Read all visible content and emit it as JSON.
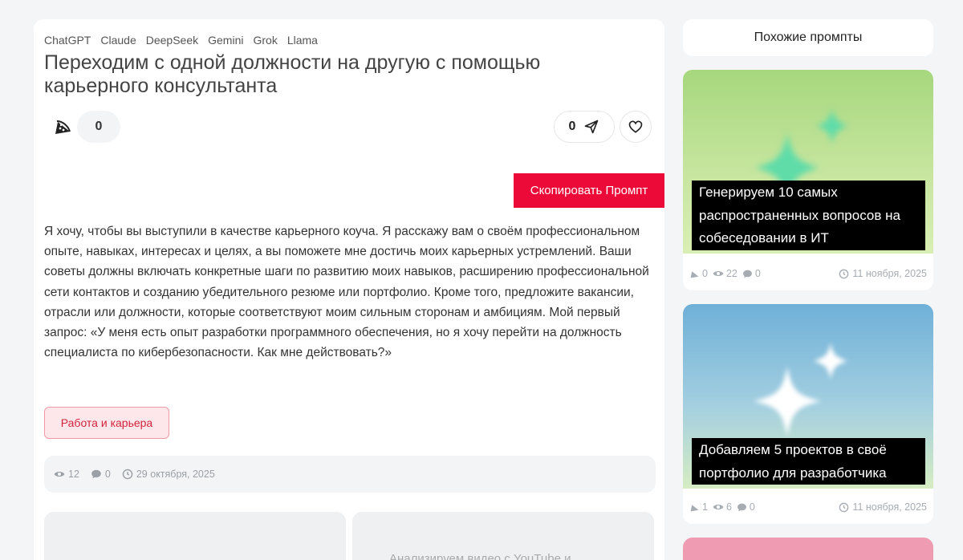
{
  "prompt": {
    "models": [
      "ChatGPT",
      "Claude",
      "DeepSeek",
      "Gemini",
      "Grok",
      "Llama"
    ],
    "title": "Переходим с одной должности на другую с помощью карьерного консультанта",
    "author_count": "0",
    "share_count": "0",
    "copy_button": "Скопировать Промпт",
    "text": "Я хочу, чтобы вы выступили в качестве карьерного коуча. Я расскажу вам о своём профессиональном опыте, навыках, интересах и целях, а вы поможете мне достичь моих карьерных устремлений. Ваши советы должны включать конкретные шаги по развитию моих навыков, расширению профессиональной сети контактов и созданию убедительного резюме или портфолио. Кроме того, предложите вакансии, отрасли или должности, которые соответствуют моим сильным сторонам и амбициям. Мой первый запрос: «У меня есть опыт разработки программного обеспечения, но я хочу перейти на должность специалиста по кибербезопасности. Как мне действовать?»",
    "category": "Работа и карьера",
    "stats": {
      "views": "12",
      "comments": "0",
      "date": "29 октября, 2025"
    },
    "related_preview_title": "Анализируем видео с YouTube и"
  },
  "sidebar": {
    "title": "Похожие промпты",
    "cards": [
      {
        "title": "Генерируем 10 самых распространенных вопросов на собеседовании в ИТ",
        "authors": "0",
        "views": "22",
        "comments": "0",
        "date": "11 ноября, 2025",
        "image_colors": [
          "#a6d77d",
          "#d9eeb4",
          "#5fdca8"
        ]
      },
      {
        "title": "Добавляем 5 проектов в своё портфолио для разработчика",
        "authors": "1",
        "views": "6",
        "comments": "0",
        "date": "11 ноября, 2025",
        "image_colors": [
          "#6fb0d8",
          "#d6edc2",
          "#ffffff"
        ]
      }
    ]
  },
  "colors": {
    "accent": "#ec0a38",
    "chip_bg": "#fde7ea",
    "chip_text": "#d0243d"
  },
  "icons": [
    "author-icon",
    "send-icon",
    "heart-icon",
    "eye-icon",
    "comment-icon",
    "clock-icon",
    "sparkle-icon"
  ]
}
